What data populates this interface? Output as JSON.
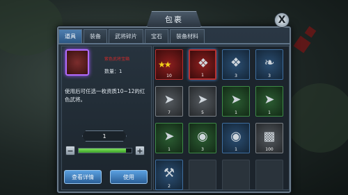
{
  "dialog": {
    "title": "包裹",
    "close_label": "X"
  },
  "tabs": [
    {
      "label": "道具",
      "active": true
    },
    {
      "label": "装备",
      "active": false
    },
    {
      "label": "武将碎片",
      "active": false
    },
    {
      "label": "宝石",
      "active": false
    },
    {
      "label": "装备材料",
      "active": false
    }
  ],
  "selected_item": {
    "name": "紫色武将宝箱",
    "count_label": "数量：1",
    "description": "使用后可任选一枚资质10~12的红色武将。"
  },
  "quantity": {
    "value": "1",
    "minus": "−",
    "plus": "+",
    "fill_fraction": 0.9
  },
  "buttons": {
    "detail": "查看详情",
    "use": "使用"
  },
  "grid_items": [
    {
      "kind": "red",
      "icon": "stars-icon",
      "count": "10",
      "stars": true
    },
    {
      "kind": "selected",
      "icon": "chest-icon",
      "count": "1"
    },
    {
      "kind": "blue",
      "icon": "chest-icon",
      "count": "3"
    },
    {
      "kind": "blue",
      "icon": "scroll-icon",
      "count": "3"
    },
    {
      "kind": "gray",
      "icon": "arrow-icon",
      "count": "7"
    },
    {
      "kind": "gray",
      "icon": "arrow-icon",
      "count": "5"
    },
    {
      "kind": "green",
      "icon": "arrow-icon",
      "count": "1"
    },
    {
      "kind": "green",
      "icon": "arrow-icon",
      "count": "1"
    },
    {
      "kind": "green",
      "icon": "arrow-icon",
      "count": "1"
    },
    {
      "kind": "green",
      "icon": "gem-icon",
      "count": "3"
    },
    {
      "kind": "blue",
      "icon": "gem-icon",
      "count": "1"
    },
    {
      "kind": "gray",
      "icon": "ore-icon",
      "count": "100"
    },
    {
      "kind": "blue",
      "icon": "hammer-icon",
      "count": "2"
    },
    {
      "kind": "empty",
      "icon": "",
      "count": ""
    },
    {
      "kind": "empty",
      "icon": "",
      "count": ""
    },
    {
      "kind": "empty",
      "icon": "",
      "count": ""
    }
  ]
}
